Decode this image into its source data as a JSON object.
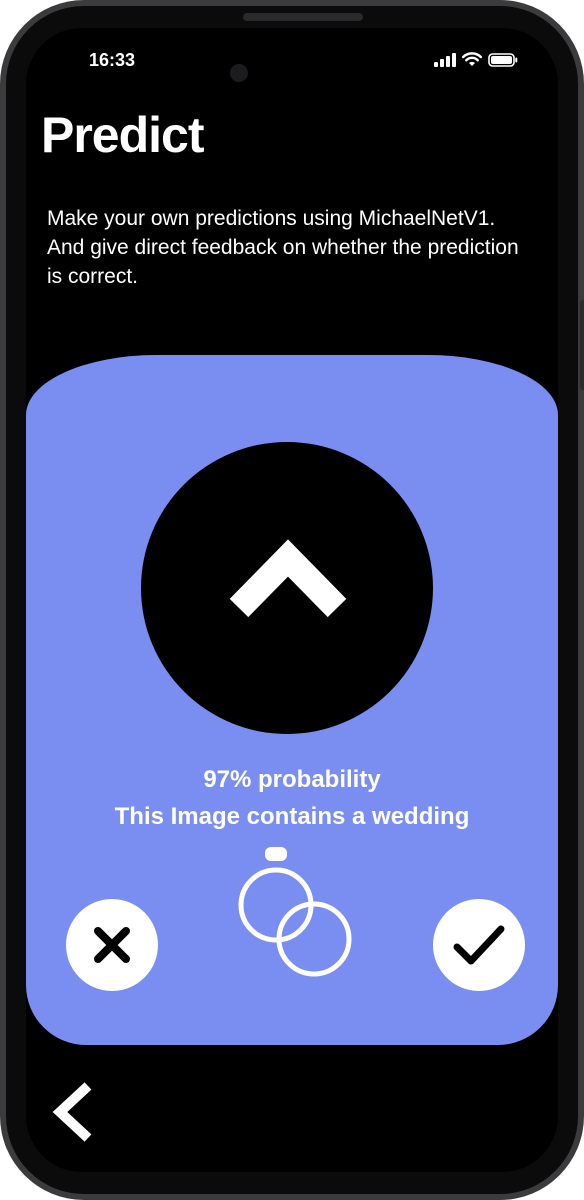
{
  "status_bar": {
    "time": "16:33",
    "icons": [
      "signal-icon",
      "wifi-icon",
      "battery-icon"
    ]
  },
  "header": {
    "title": "Predict",
    "description": "Make your own predictions using MichaelNetV1. And give direct feedback on whether the prediction is correct."
  },
  "prediction": {
    "probability_text": "97% probability",
    "label_text": "This Image contains a wedding",
    "probability": 0.97,
    "category_icon": "wedding-rings-icon",
    "image_icon": "chevron-up-icon"
  },
  "actions": {
    "reject_icon": "close-icon",
    "accept_icon": "checkmark-icon",
    "back_icon": "chevron-left-icon"
  },
  "colors": {
    "card": "#7a8ef2",
    "background": "#000000",
    "text": "#ffffff"
  }
}
